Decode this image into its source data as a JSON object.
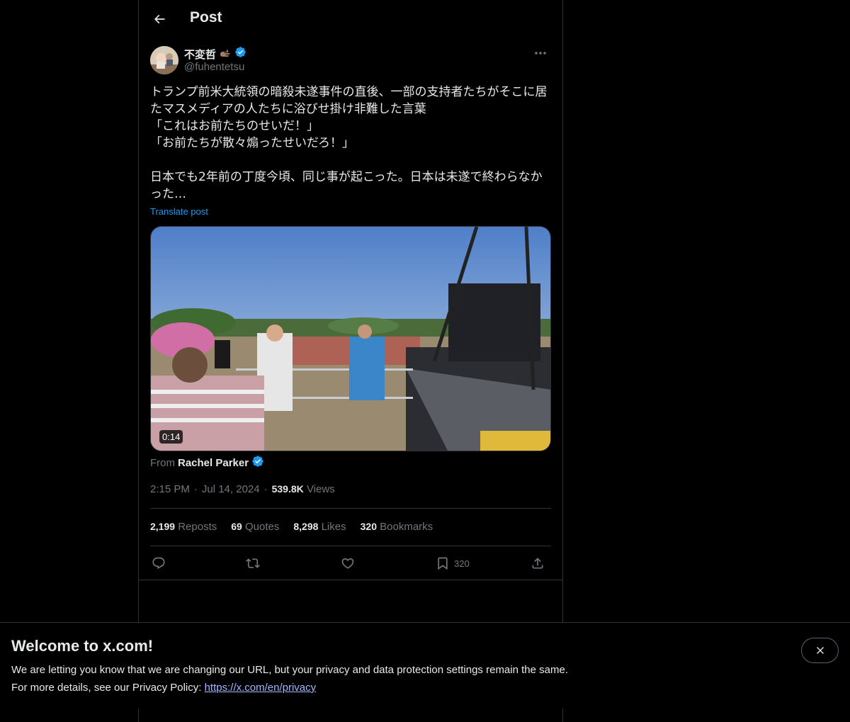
{
  "header": {
    "title": "Post"
  },
  "author": {
    "display_name": "不変哲",
    "handle": "@fuhentetsu",
    "verified": true,
    "emoji_icon": "pinching-hand-icon"
  },
  "tweet": {
    "text": "トランプ前米大統領の暗殺未遂事件の直後、一部の支持者たちがそこに居たマスメディアの人たちに浴びせ掛け非難した言葉\n「これはお前たちのせいだ！」\n「お前たちが散々煽ったせいだろ！」\n\n日本でも2年前の丁度今頃、同じ事が起こった。日本は未遂で終わらなかった…",
    "translate_label": "Translate post",
    "video_duration": "0:14",
    "from_label": "From",
    "from_name": "Rachel Parker",
    "time": "2:15 PM",
    "date": "Jul 14, 2024",
    "views_count": "539.8K",
    "views_label": "Views"
  },
  "stats": [
    {
      "num": "2,199",
      "label": "Reposts"
    },
    {
      "num": "69",
      "label": "Quotes"
    },
    {
      "num": "8,298",
      "label": "Likes"
    },
    {
      "num": "320",
      "label": "Bookmarks"
    }
  ],
  "actions": {
    "reply_icon": "reply-icon",
    "repost_icon": "repost-icon",
    "like_icon": "heart-icon",
    "bookmark_icon": "bookmark-icon",
    "bookmark_count": "320",
    "share_icon": "share-icon"
  },
  "banner": {
    "title": "Welcome to x.com!",
    "line1": "We are letting you know that we are changing our URL, but your privacy and data protection settings remain the same.",
    "line2_prefix": "For more details, see our Privacy Policy: ",
    "link": "https://x.com/en/privacy"
  },
  "colors": {
    "background": "#000000",
    "text": "#e7e9ea",
    "muted": "#71767b",
    "accent": "#1d9bf0",
    "border": "#2f3336"
  }
}
